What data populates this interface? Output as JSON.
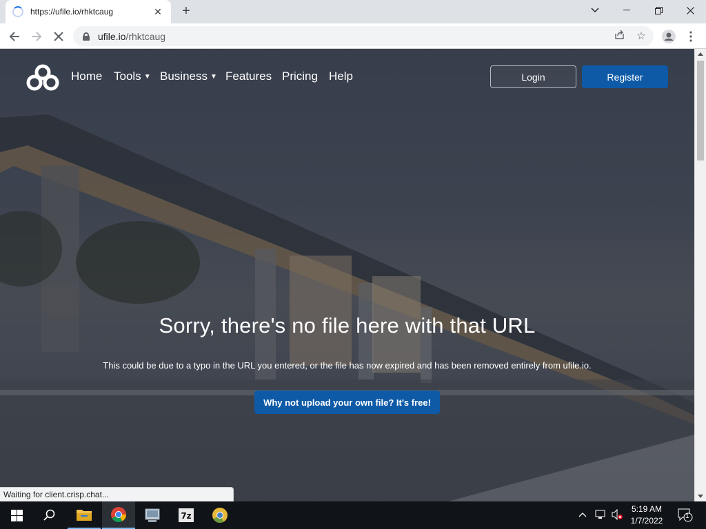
{
  "browser": {
    "tab_title": "https://ufile.io/rhktcaug",
    "url_host": "ufile.io",
    "url_path": "/rhktcaug",
    "status_text": "Waiting for client.crisp.chat..."
  },
  "nav": {
    "items": [
      {
        "label": "Home"
      },
      {
        "label": "Tools"
      },
      {
        "label": "Business"
      },
      {
        "label": "Features"
      },
      {
        "label": "Pricing"
      },
      {
        "label": "Help"
      }
    ],
    "login_label": "Login",
    "register_label": "Register"
  },
  "hero": {
    "title": "Sorry, there's no file here with that URL",
    "subtitle": "This could be due to a typo in the URL you entered, or the file has now expired and has been removed entirely from ufile.io.",
    "cta_label": "Why not upload your own file? It's free!"
  },
  "taskbar": {
    "time": "5:19 AM",
    "date": "1/7/2022",
    "notification_count": "1"
  },
  "colors": {
    "accent": "#0e5aa7",
    "taskbar": "#101318"
  }
}
